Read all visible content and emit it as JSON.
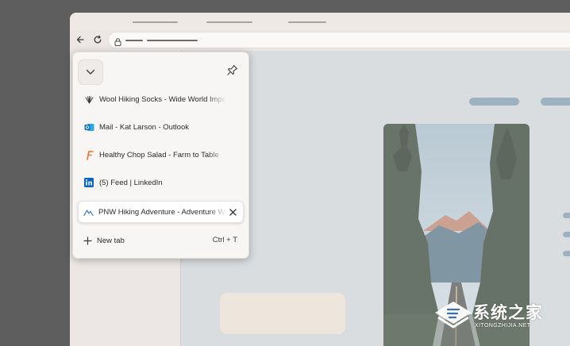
{
  "window": {
    "toolbar": {
      "back_icon": "back-arrow-icon",
      "reload_icon": "reload-icon",
      "lock_icon": "lock-icon"
    }
  },
  "tab_popup": {
    "tabs": [
      {
        "title": "Wool Hiking Socks - Wide World Importers",
        "favicon": "wool-socks-icon",
        "active": false
      },
      {
        "title": "Mail - Kat Larson - Outlook",
        "favicon": "outlook-icon",
        "active": false
      },
      {
        "title": "Healthy Chop Salad - Farm to Table",
        "favicon": "farm-to-table-icon",
        "active": false
      },
      {
        "title": "(5) Feed | LinkedIn",
        "favicon": "linkedin-icon",
        "active": false
      },
      {
        "title": "PNW Hiking Adventure - Adventure Works",
        "favicon": "adventure-works-icon",
        "active": true
      }
    ],
    "new_tab_label": "New tab",
    "new_tab_shortcut": "Ctrl + T"
  },
  "watermark": {
    "text": "系统之家",
    "subtext": "XITONGZHIJIA.NET"
  },
  "colors": {
    "desktop": "#5e5e5e",
    "content_bg": "#d9dde0",
    "pill_blue": "#9db2c0",
    "outlook_blue": "#0f6cbd",
    "linkedin_blue": "#0a66c2",
    "farm_orange": "#e8742c"
  }
}
